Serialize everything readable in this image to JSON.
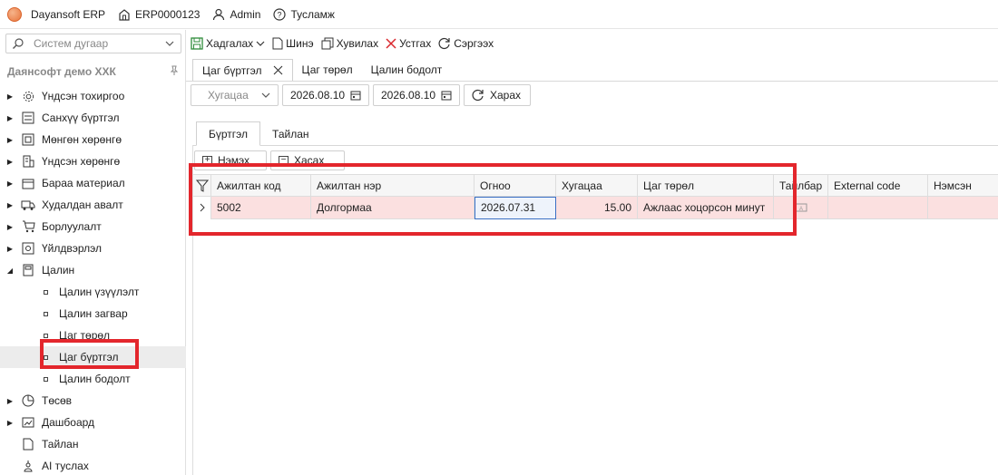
{
  "titlebar": {
    "app_name": "Dayansoft ERP",
    "code": "ERP0000123",
    "user": "Admin",
    "help": "Тусламж"
  },
  "sidebar": {
    "search_placeholder": "Систем дугаар",
    "company": "Даянсофт демо ХХК",
    "items": [
      {
        "label": "Үндсэн тохиргоо",
        "icon": "gear-icon"
      },
      {
        "label": "Санхүү бүртгэл",
        "icon": "ledger-icon"
      },
      {
        "label": "Мөнгөн хөрөнгө",
        "icon": "cash-icon"
      },
      {
        "label": "Үндсэн хөрөнгө",
        "icon": "building-icon"
      },
      {
        "label": "Бараа материал",
        "icon": "box-icon"
      },
      {
        "label": "Худалдан авалт",
        "icon": "truck-icon"
      },
      {
        "label": "Борлуулалт",
        "icon": "cart-icon"
      },
      {
        "label": "Үйлдвэрлэл",
        "icon": "factory-icon"
      },
      {
        "label": "Цалин",
        "icon": "calculator-icon"
      }
    ],
    "salary_sub": [
      {
        "label": "Цалин үзүүлэлт"
      },
      {
        "label": "Цалин загвар"
      },
      {
        "label": "Цаг төрөл"
      },
      {
        "label": "Цаг бүртгэл"
      },
      {
        "label": "Цалин бодолт"
      }
    ],
    "items_after": [
      {
        "label": "Төсөв",
        "icon": "pie-icon"
      },
      {
        "label": "Дашбоард",
        "icon": "dashboard-icon"
      },
      {
        "label": "Тайлан",
        "icon": "report-icon"
      },
      {
        "label": "AI туслах",
        "icon": "ai-icon"
      }
    ]
  },
  "toolbar": {
    "save": "Хадгалах",
    "new": "Шинэ",
    "copy": "Хувилах",
    "delete": "Устгах",
    "refresh": "Сэргээх"
  },
  "doctabs": [
    {
      "label": "Цаг бүртгэл",
      "active": true
    },
    {
      "label": "Цаг төрөл",
      "active": false
    },
    {
      "label": "Цалин бодолт",
      "active": false
    }
  ],
  "filter": {
    "period_placeholder": "Хугацаа",
    "date_from": "2026.08.10",
    "date_to": "2026.08.10",
    "view": "Харах"
  },
  "inner_tabs": [
    {
      "label": "Бүртгэл",
      "active": true
    },
    {
      "label": "Тайлан",
      "active": false
    }
  ],
  "grid_buttons": {
    "add": "Нэмэх",
    "remove": "Хасах"
  },
  "grid": {
    "columns": [
      "Ажилтан код",
      "Ажилтан нэр",
      "Огноо",
      "Хугацаа",
      "Цаг төрөл",
      "Тайлбар",
      "External code",
      "Нэмсэн"
    ],
    "rows": [
      [
        "5002",
        "Долгормаа",
        "2026.07.31",
        "15.00",
        "Ажлаас хоцорсон минут",
        "",
        "",
        ""
      ]
    ]
  },
  "colors": {
    "highlight_red": "#e3262c",
    "row_pink": "#fbe0e0",
    "save_green": "#2e8b3a",
    "delete_red": "#d9262c"
  }
}
